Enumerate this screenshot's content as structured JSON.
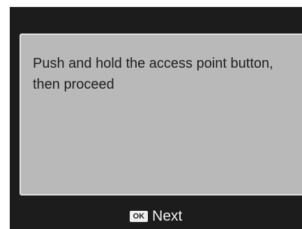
{
  "dialog": {
    "message": "Push and hold the access point button, then proceed"
  },
  "footer": {
    "ok_key_label": "OK",
    "next_label": "Next"
  },
  "colors": {
    "screen_background": "#1c1c1c",
    "panel_background": "#b9b9b9",
    "panel_border": "#e4e4e4",
    "text_dark": "#1e1e1e",
    "text_light": "#f2f2f2"
  }
}
